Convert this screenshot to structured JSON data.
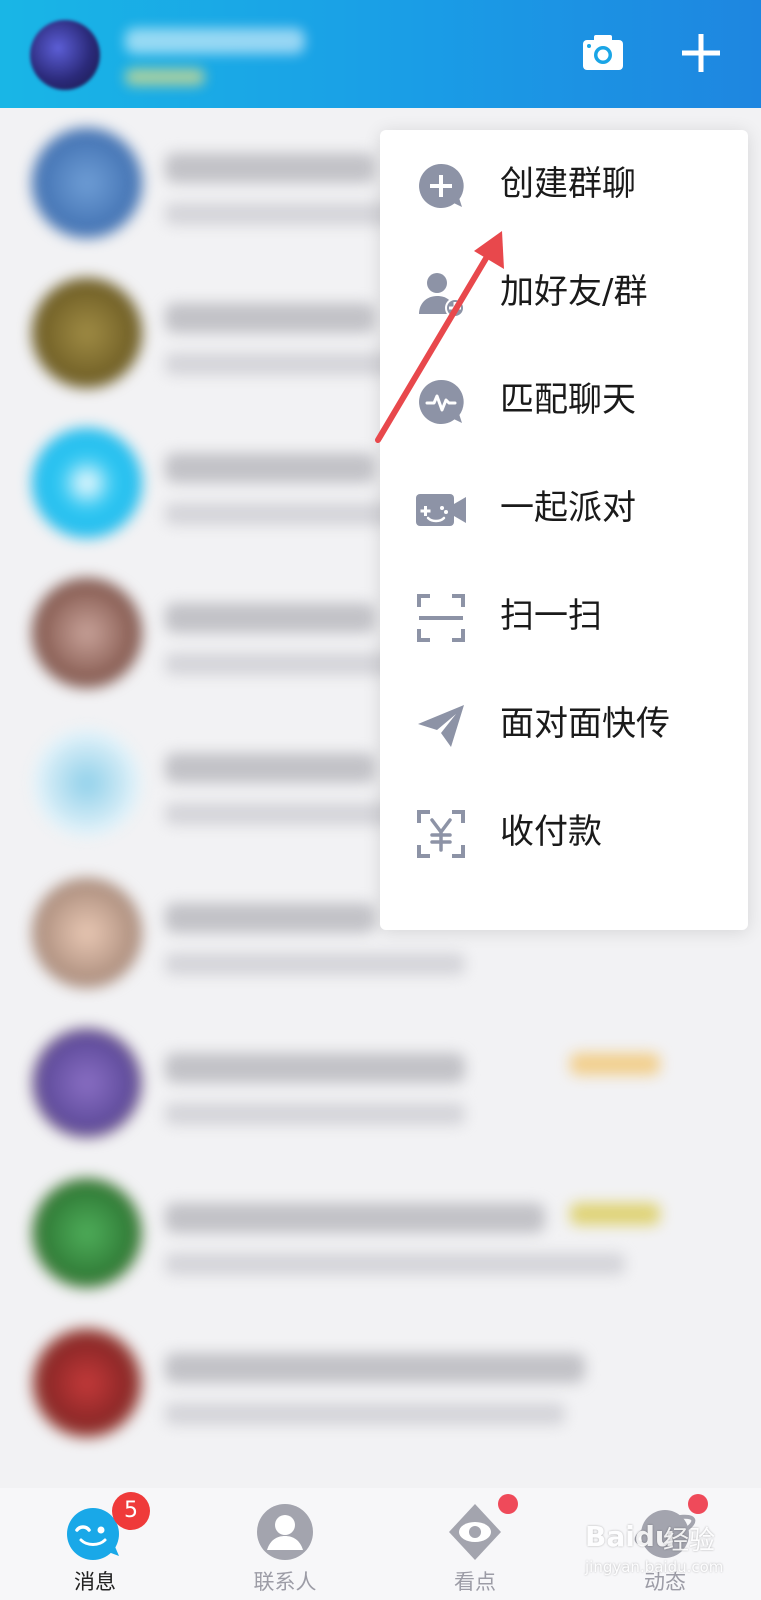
{
  "menu": {
    "items": [
      {
        "label": "创建群聊",
        "icon": "create-group-chat-icon"
      },
      {
        "label": "加好友/群",
        "icon": "add-friend-icon"
      },
      {
        "label": "匹配聊天",
        "icon": "match-chat-icon"
      },
      {
        "label": "一起派对",
        "icon": "party-game-icon"
      },
      {
        "label": "扫一扫",
        "icon": "scan-icon"
      },
      {
        "label": "面对面快传",
        "icon": "face-to-face-transfer-icon"
      },
      {
        "label": "收付款",
        "icon": "payment-icon"
      }
    ]
  },
  "tabbar": {
    "tabs": [
      {
        "label": "消息",
        "icon": "messages-icon",
        "badge": "5",
        "active": true
      },
      {
        "label": "联系人",
        "icon": "contacts-icon"
      },
      {
        "label": "看点",
        "icon": "watch-points-icon",
        "dot": true
      },
      {
        "label": "动态",
        "icon": "dynamics-icon",
        "dot": true
      }
    ]
  },
  "watermark": {
    "brand": "Baidu",
    "suffix": "经验",
    "url": "jingyan.baidu.com"
  },
  "colors": {
    "header_start": "#19b6e6",
    "header_end": "#1e86e0",
    "menu_icon": "#8d93a6",
    "badge": "#ef3a3a",
    "arrow": "#e8484c"
  }
}
